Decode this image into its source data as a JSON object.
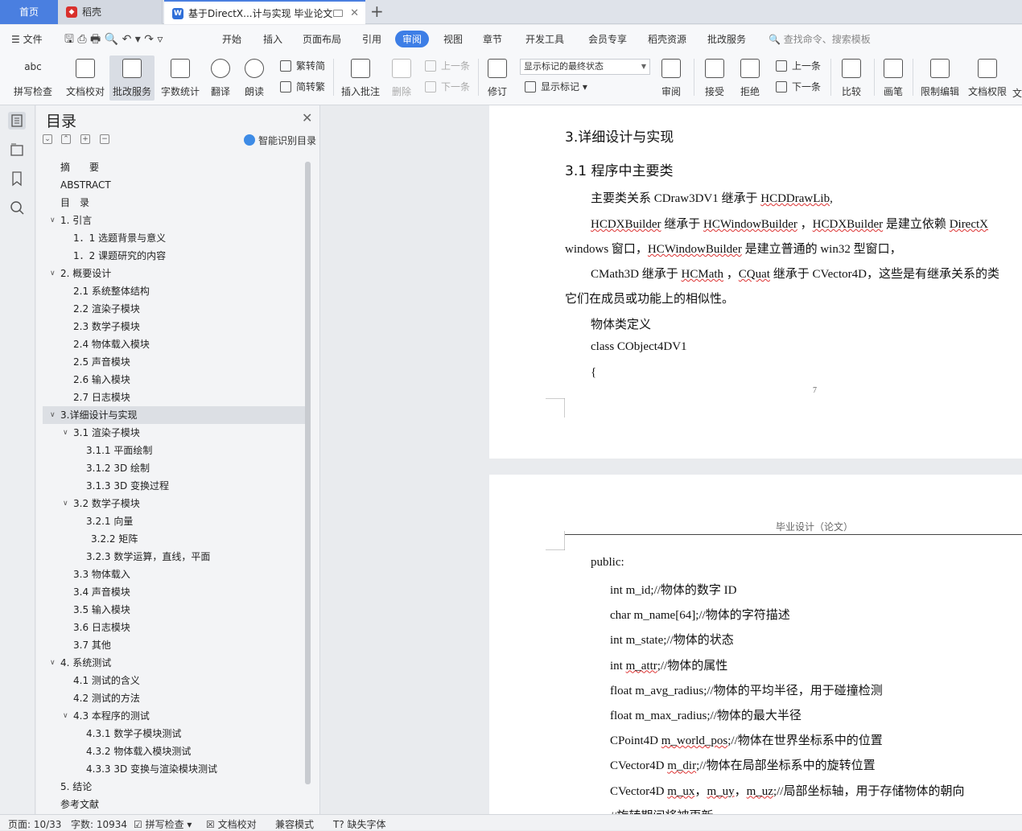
{
  "tabs": {
    "home": "首页",
    "docer": "稻壳",
    "document": "基于DirectX...计与实现 毕业论文"
  },
  "menu": {
    "file": "文件",
    "items": [
      "开始",
      "插入",
      "页面布局",
      "引用",
      "审阅",
      "视图",
      "章节",
      "开发工具",
      "会员专享",
      "稻壳资源",
      "批改服务"
    ],
    "search_placeholder": "查找命令、搜索模板"
  },
  "toolbar": {
    "spell_check": "拼写检查",
    "doc_proof": "文档校对",
    "correction_service": "批改服务",
    "word_count": "字数统计",
    "translate": "翻译",
    "read_aloud": "朗读",
    "trad_to_simp": "繁转简",
    "simp_to_trad": "简转繁",
    "insert_comment": "插入批注",
    "delete": "删除",
    "prev_item": "上一条",
    "next_item": "下一条",
    "revise": "修订",
    "markup_state": "显示标记的最终状态",
    "show_markup": "显示标记",
    "review": "审阅",
    "accept": "接受",
    "reject": "拒绝",
    "prev": "上一条",
    "next": "下一条",
    "compare": "比较",
    "pen": "画笔",
    "restrict_edit": "限制编辑",
    "doc_permission": "文档权限",
    "partial": "文"
  },
  "toc": {
    "title": "目录",
    "smart": "智能识别目录",
    "items": [
      {
        "label": "摘　　要",
        "level": 0,
        "arrow": ""
      },
      {
        "label": "ABSTRACT",
        "level": 0,
        "arrow": ""
      },
      {
        "label": "目　录",
        "level": 0,
        "arrow": ""
      },
      {
        "label": "1. 引言",
        "level": 0,
        "arrow": "v"
      },
      {
        "label": "1．1 选题背景与意义",
        "level": 1,
        "arrow": ""
      },
      {
        "label": "1．2  课题研究的内容",
        "level": 1,
        "arrow": ""
      },
      {
        "label": "2. 概要设计",
        "level": 0,
        "arrow": "v"
      },
      {
        "label": "2.1  系统整体结构",
        "level": 1,
        "arrow": ""
      },
      {
        "label": "2.2  渲染子模块",
        "level": 1,
        "arrow": ""
      },
      {
        "label": "2.3  数学子模块",
        "level": 1,
        "arrow": ""
      },
      {
        "label": "2.4  物体载入模块",
        "level": 1,
        "arrow": ""
      },
      {
        "label": "2.5  声音模块",
        "level": 1,
        "arrow": ""
      },
      {
        "label": "2.6  输入模块",
        "level": 1,
        "arrow": ""
      },
      {
        "label": "2.7  日志模块",
        "level": 1,
        "arrow": ""
      },
      {
        "label": "3.详细设计与实现",
        "level": 0,
        "arrow": "v",
        "selected": true
      },
      {
        "label": "3.1  渲染子模块",
        "level": 1,
        "arrow": "v"
      },
      {
        "label": "3.1.1  平面绘制",
        "level": 2,
        "arrow": ""
      },
      {
        "label": "3.1.2 3D 绘制",
        "level": 2,
        "arrow": ""
      },
      {
        "label": "3.1.3 3D 变换过程",
        "level": 2,
        "arrow": ""
      },
      {
        "label": "3.2  数学子模块",
        "level": 1,
        "arrow": "v"
      },
      {
        "label": "3.2.1  向量",
        "level": 2,
        "arrow": ""
      },
      {
        "label": "3.2.2  矩阵",
        "level": 2,
        "arrow": "",
        "shift": true
      },
      {
        "label": "3.2.3  数学运算，直线，平面",
        "level": 2,
        "arrow": ""
      },
      {
        "label": "3.3  物体载入",
        "level": 1,
        "arrow": ""
      },
      {
        "label": "3.4  声音模块",
        "level": 1,
        "arrow": ""
      },
      {
        "label": "3.5  输入模块",
        "level": 1,
        "arrow": ""
      },
      {
        "label": "3.6  日志模块",
        "level": 1,
        "arrow": ""
      },
      {
        "label": "3.7  其他",
        "level": 1,
        "arrow": ""
      },
      {
        "label": "4.  系统测试",
        "level": 0,
        "arrow": "v"
      },
      {
        "label": "4.1  测试的含义",
        "level": 1,
        "arrow": ""
      },
      {
        "label": "4.2  测试的方法",
        "level": 1,
        "arrow": ""
      },
      {
        "label": "4.3 本程序的测试",
        "level": 1,
        "arrow": "v"
      },
      {
        "label": "4.3.1  数学子模块测试",
        "level": 2,
        "arrow": ""
      },
      {
        "label": "4.3.2  物体载入模块测试",
        "level": 2,
        "arrow": ""
      },
      {
        "label": "4.3.3 3D 变换与渲染模块测试",
        "level": 2,
        "arrow": ""
      },
      {
        "label": "5. 结论",
        "level": 0,
        "arrow": ""
      },
      {
        "label": "参考文献",
        "level": 0,
        "arrow": ""
      }
    ]
  },
  "page1": {
    "heading": "3.详细设计与实现",
    "subheading": "3.1 程序中主要类",
    "line1_a": "主要类关系 CDraw3DV1 继承于 ",
    "line1_b": "HCDDrawLib",
    "line1_c": ",",
    "line2_a": "HCDXBuilder",
    "line2_b": " 继承于 ",
    "line2_c": "HCWindowBuilder",
    "line2_d": " ，",
    "line2_e": "HCDXBuilder",
    "line2_f": " 是建立依赖 ",
    "line2_g": "DirectX",
    "line3_a": "windows 窗口，",
    "line3_b": "HCWindowBuilder",
    "line3_c": " 是建立普通的 win32 型窗口，",
    "line4_a": "CMath3D 继承于 ",
    "line4_b": "HCMath",
    "line4_c": " ，",
    "line4_d": "CQuat",
    "line4_e": " 继承于 CVector4D，这些是有继承关系的类",
    "line5": "它们在成员或功能上的相似性。",
    "line6": "物体类定义",
    "line7": "class CObject4DV1",
    "line8": "{",
    "page_number": "7"
  },
  "page2": {
    "header": "毕业设计（论文）",
    "public": "public:",
    "code": [
      {
        "a": "int m_id;//物体的数字 ID",
        "sq": ""
      },
      {
        "a": "char m_name[64];//物体的字符描述",
        "sq": ""
      },
      {
        "a": "int m_state;//物体的状态",
        "sq": ""
      },
      {
        "a": "int ",
        "sq": "m_attr",
        "b": ";//物体的属性"
      },
      {
        "a": "float m_avg_radius;//物体的平均半径，用于碰撞检测",
        "sq": ""
      },
      {
        "a": "float m_max_radius;//物体的最大半径",
        "sq": ""
      },
      {
        "a": "CPoint4D ",
        "sq": "m_world_pos",
        "b": ";//物体在世界坐标系中的位置"
      },
      {
        "a": "CVector4D ",
        "sq": "m_dir",
        "b": ";//物体在局部坐标系中的旋转位置"
      },
      {
        "a": "CVector4D ",
        "sq": "m_ux",
        "b": "，",
        "sq2": "m_uy",
        "c": "，",
        "sq3": "m_uz",
        "d": ";//局部坐标轴，用于存储物体的朝向"
      },
      {
        "a": "//旋转期间将被更新",
        "sq": ""
      }
    ]
  },
  "status": {
    "page": "页面: 10/33",
    "words": "字数: 10934",
    "spell": "拼写检查",
    "proof": "文档校对",
    "compat": "兼容模式",
    "missing_font": "缺失字体"
  }
}
